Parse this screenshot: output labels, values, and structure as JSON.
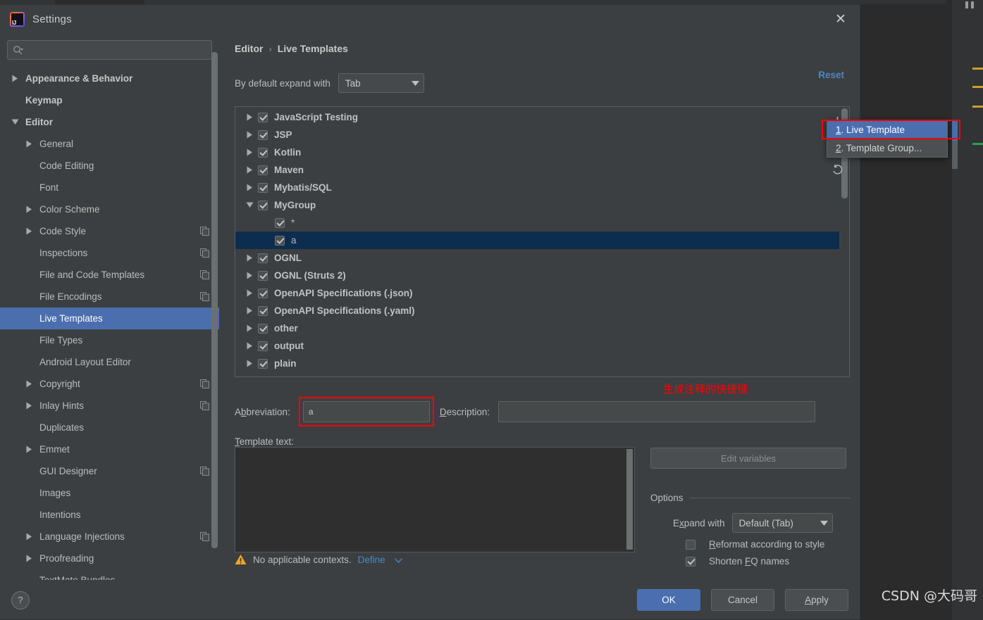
{
  "window": {
    "title": "Settings",
    "close_icon": "close-icon",
    "app_icon": "intellij-idea-logo"
  },
  "search": {
    "value": "",
    "placeholder": "",
    "icon": "search-icon"
  },
  "sidebar": {
    "items": [
      {
        "label": "Appearance & Behavior",
        "indent": 0,
        "arrow": "collapsed",
        "bold": true,
        "copy": false,
        "selected": false
      },
      {
        "label": "Keymap",
        "indent": 0,
        "arrow": "none",
        "bold": true,
        "copy": false,
        "selected": false
      },
      {
        "label": "Editor",
        "indent": 0,
        "arrow": "expanded",
        "bold": true,
        "copy": false,
        "selected": false
      },
      {
        "label": "General",
        "indent": 1,
        "arrow": "collapsed",
        "bold": false,
        "copy": false,
        "selected": false
      },
      {
        "label": "Code Editing",
        "indent": 1,
        "arrow": "none",
        "bold": false,
        "copy": false,
        "selected": false
      },
      {
        "label": "Font",
        "indent": 1,
        "arrow": "none",
        "bold": false,
        "copy": false,
        "selected": false
      },
      {
        "label": "Color Scheme",
        "indent": 1,
        "arrow": "collapsed",
        "bold": false,
        "copy": false,
        "selected": false
      },
      {
        "label": "Code Style",
        "indent": 1,
        "arrow": "collapsed",
        "bold": false,
        "copy": true,
        "selected": false
      },
      {
        "label": "Inspections",
        "indent": 1,
        "arrow": "none",
        "bold": false,
        "copy": true,
        "selected": false
      },
      {
        "label": "File and Code Templates",
        "indent": 1,
        "arrow": "none",
        "bold": false,
        "copy": true,
        "selected": false
      },
      {
        "label": "File Encodings",
        "indent": 1,
        "arrow": "none",
        "bold": false,
        "copy": true,
        "selected": false
      },
      {
        "label": "Live Templates",
        "indent": 1,
        "arrow": "none",
        "bold": false,
        "copy": false,
        "selected": true
      },
      {
        "label": "File Types",
        "indent": 1,
        "arrow": "none",
        "bold": false,
        "copy": false,
        "selected": false
      },
      {
        "label": "Android Layout Editor",
        "indent": 1,
        "arrow": "none",
        "bold": false,
        "copy": false,
        "selected": false
      },
      {
        "label": "Copyright",
        "indent": 1,
        "arrow": "collapsed",
        "bold": false,
        "copy": true,
        "selected": false
      },
      {
        "label": "Inlay Hints",
        "indent": 1,
        "arrow": "collapsed",
        "bold": false,
        "copy": true,
        "selected": false
      },
      {
        "label": "Duplicates",
        "indent": 1,
        "arrow": "none",
        "bold": false,
        "copy": false,
        "selected": false
      },
      {
        "label": "Emmet",
        "indent": 1,
        "arrow": "collapsed",
        "bold": false,
        "copy": false,
        "selected": false
      },
      {
        "label": "GUI Designer",
        "indent": 1,
        "arrow": "none",
        "bold": false,
        "copy": true,
        "selected": false
      },
      {
        "label": "Images",
        "indent": 1,
        "arrow": "none",
        "bold": false,
        "copy": false,
        "selected": false
      },
      {
        "label": "Intentions",
        "indent": 1,
        "arrow": "none",
        "bold": false,
        "copy": false,
        "selected": false
      },
      {
        "label": "Language Injections",
        "indent": 1,
        "arrow": "collapsed",
        "bold": false,
        "copy": true,
        "selected": false
      },
      {
        "label": "Proofreading",
        "indent": 1,
        "arrow": "collapsed",
        "bold": false,
        "copy": false,
        "selected": false
      },
      {
        "label": "TextMate Bundles",
        "indent": 1,
        "arrow": "none",
        "bold": false,
        "copy": false,
        "selected": false
      }
    ]
  },
  "main": {
    "breadcrumb_root": "Editor",
    "breadcrumb_sep": "›",
    "breadcrumb_leaf": "Live Templates",
    "reset_label": "Reset",
    "expand_label": "By default expand with",
    "expand_value": "Tab",
    "annotation_cn": "生成注释的快捷键"
  },
  "template_tree": {
    "rows": [
      {
        "label": "JavaScript Testing",
        "arrow": "collapsed",
        "checked": true,
        "child": false,
        "selected": false
      },
      {
        "label": "JSP",
        "arrow": "collapsed",
        "checked": true,
        "child": false,
        "selected": false
      },
      {
        "label": "Kotlin",
        "arrow": "collapsed",
        "checked": true,
        "child": false,
        "selected": false
      },
      {
        "label": "Maven",
        "arrow": "collapsed",
        "checked": true,
        "child": false,
        "selected": false
      },
      {
        "label": "Mybatis/SQL",
        "arrow": "collapsed",
        "checked": true,
        "child": false,
        "selected": false
      },
      {
        "label": "MyGroup",
        "arrow": "expanded",
        "checked": true,
        "child": false,
        "selected": false
      },
      {
        "label": "*",
        "arrow": "none",
        "checked": true,
        "child": true,
        "selected": false
      },
      {
        "label": "a",
        "arrow": "none",
        "checked": true,
        "child": true,
        "selected": true
      },
      {
        "label": "OGNL",
        "arrow": "collapsed",
        "checked": true,
        "child": false,
        "selected": false
      },
      {
        "label": "OGNL (Struts 2)",
        "arrow": "collapsed",
        "checked": true,
        "child": false,
        "selected": false
      },
      {
        "label": "OpenAPI Specifications (.json)",
        "arrow": "collapsed",
        "checked": true,
        "child": false,
        "selected": false
      },
      {
        "label": "OpenAPI Specifications (.yaml)",
        "arrow": "collapsed",
        "checked": true,
        "child": false,
        "selected": false
      },
      {
        "label": "other",
        "arrow": "collapsed",
        "checked": true,
        "child": false,
        "selected": false
      },
      {
        "label": "output",
        "arrow": "collapsed",
        "checked": true,
        "child": false,
        "selected": false
      },
      {
        "label": "plain",
        "arrow": "collapsed",
        "checked": true,
        "child": false,
        "selected": false
      }
    ],
    "toolbar": {
      "add": "+",
      "remove": "−",
      "revert_icon": "revert-arrow-icon"
    }
  },
  "add_menu": {
    "items": [
      {
        "num": "1",
        "label": ". Live Template",
        "highlighted": true
      },
      {
        "num": "2",
        "label": ". Template Group...",
        "highlighted": false
      }
    ]
  },
  "form": {
    "abbreviation_label_pre": "A",
    "abbreviation_label_key": "b",
    "abbreviation_label_post": "breviation:",
    "abbreviation_value": "a",
    "description_label_key": "D",
    "description_label_post": "escription:",
    "description_value": "",
    "template_text_label_key": "T",
    "template_text_label_post": "emplate text:",
    "template_text_value": "",
    "edit_variables_label": "Edit variables"
  },
  "options": {
    "legend": "Options",
    "expand_with_label_pre": "E",
    "expand_with_label_key": "x",
    "expand_with_label_post": "pand with",
    "expand_with_value": "Default (Tab)",
    "reformat_label_key": "R",
    "reformat_label_post": "eformat according to style",
    "reformat_checked": false,
    "shorten_label_pre": "Shorten ",
    "shorten_label_key": "F",
    "shorten_label_post": "Q names",
    "shorten_checked": true
  },
  "context": {
    "warning_icon": "warning-triangle-icon",
    "message": "No applicable contexts.",
    "define_label": "Define",
    "define_caret": "∨"
  },
  "footer": {
    "help_label": "?",
    "ok_label": "OK",
    "cancel_label": "Cancel",
    "apply_label_key": "A",
    "apply_label_post": "pply"
  },
  "watermark": {
    "text": "CSDN @大码哥"
  },
  "colors": {
    "accent_selection": "#4b6eaf",
    "tree_selection": "#0d2d4e",
    "link": "#4a88c7",
    "annotation_red": "#ff0000",
    "panel_bg": "#3c3f41",
    "editor_bg": "#2b2b2b",
    "warning": "#f5a623"
  }
}
